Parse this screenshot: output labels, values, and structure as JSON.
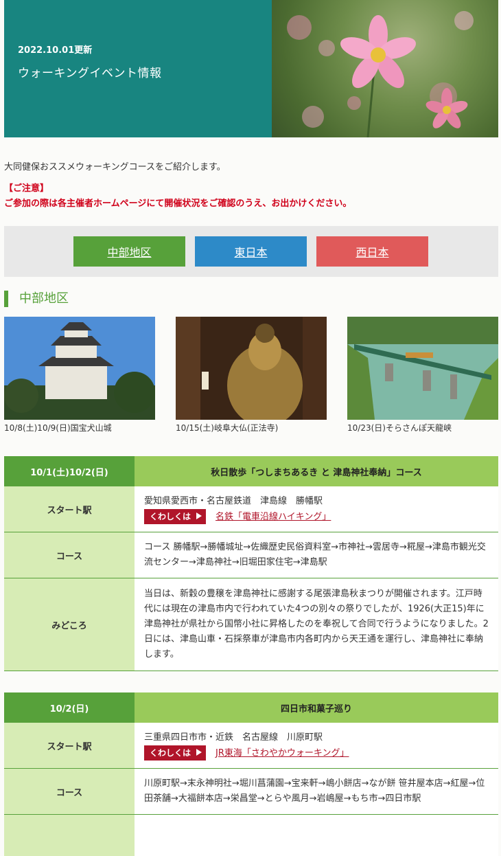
{
  "header": {
    "date": "2022.10.01更新",
    "title": "ウォーキングイベント情報"
  },
  "intro": "大同健保おススメウォーキングコースをご紹介します。",
  "notice": {
    "heading": "【ご注意】",
    "text": "ご参加の際は各主催者ホームページにて開催状況をご確認のうえ、お出かけください。"
  },
  "nav": {
    "chubu": "中部地区",
    "east": "東日本",
    "west": "西日本"
  },
  "section": {
    "title": "中部地区"
  },
  "photos": [
    {
      "caption": "10/8(土)10/9(日)国宝犬山城"
    },
    {
      "caption": "10/15(土)岐阜大仏(正法寺)"
    },
    {
      "caption": "10/23(日)そらさんぽ天龍峡"
    }
  ],
  "events": [
    {
      "date": "10/1(土)10/2(日)",
      "title": "秋日散歩「つしまちあるき と 津島神社奉納」コース",
      "start_label": "スタート駅",
      "start": "愛知県愛西市・名古屋鉄道　津島線　勝幡駅",
      "detail_btn": "くわしくは",
      "link": "名鉄「電車沿線ハイキング」",
      "course_label": "コース",
      "course": "コース 勝幡駅→勝幡城址→佐織歴史民俗資料室→市神社→雲居寺→糀屋→津島市観光交流センター→津島神社→旧堀田家住宅→津島駅",
      "highlight_label": "みどころ",
      "highlight": "当日は、新穀の豊穣を津島神社に感謝する尾張津島秋まつりが開催されます。江戸時代には現在の津島市内で行われていた4つの別々の祭りでしたが、1926(大正15)年に津島神社が県社から国幣小社に昇格したのを奉祝して合同で行うようになりました。2日には、津島山車・石採祭車が津島市内各町内から天王通を運行し、津島神社に奉納します。"
    },
    {
      "date": "10/2(日)",
      "title": "四日市和菓子巡り",
      "start_label": "スタート駅",
      "start": "三重県四日市市・近鉄　名古屋線　川原町駅",
      "detail_btn": "くわしくは",
      "link": "JR東海「さわやかウォーキング」",
      "course_label": "コース",
      "course": "川原町駅→末永神明社→堀川菖蒲園→宝来軒→嶋小餅店→なが餅 笹井屋本店→紅屋→位田茶舗→大福餅本店→栄昌堂→とらや風月→岩嶋屋→もち市→四日市駅"
    }
  ],
  "colors": {
    "teal": "#188580",
    "green": "#57a13a",
    "blue": "#2d8ac8",
    "red": "#e05a5a",
    "alert": "#d0021b"
  }
}
